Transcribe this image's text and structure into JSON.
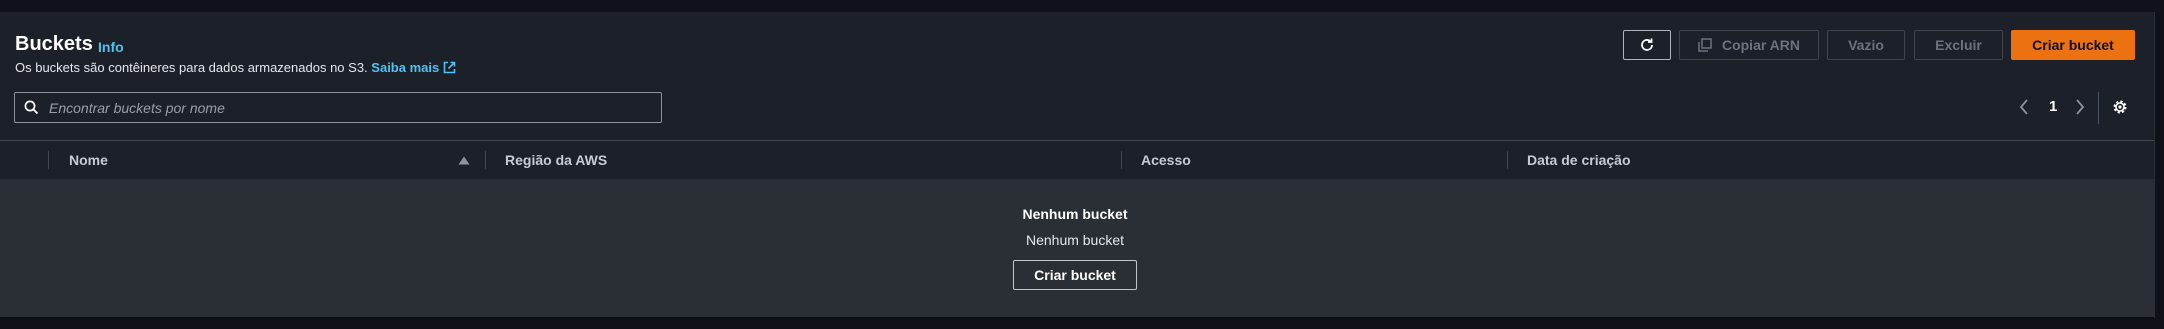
{
  "header": {
    "title": "Buckets",
    "info_label": "Info",
    "description": "Os buckets são contêineres para dados armazenados no S3.",
    "learn_more_label": "Saiba mais"
  },
  "toolbar": {
    "refresh_icon": "refresh-icon",
    "copy_arn_label": "Copiar ARN",
    "empty_label": "Vazio",
    "delete_label": "Excluir",
    "create_label": "Criar bucket"
  },
  "search": {
    "placeholder": "Encontrar buckets por nome",
    "value": ""
  },
  "pagination": {
    "current_page": "1"
  },
  "table": {
    "columns": [
      "Nome",
      "Região da AWS",
      "Acesso",
      "Data de criação"
    ],
    "sort_column": "Nome",
    "rows": []
  },
  "empty_state": {
    "title": "Nenhum bucket",
    "subtitle": "Nenhum bucket",
    "button_label": "Criar bucket"
  },
  "colors": {
    "accent": "#ec7211",
    "link": "#4cc3f0",
    "background": "#1c2028"
  }
}
